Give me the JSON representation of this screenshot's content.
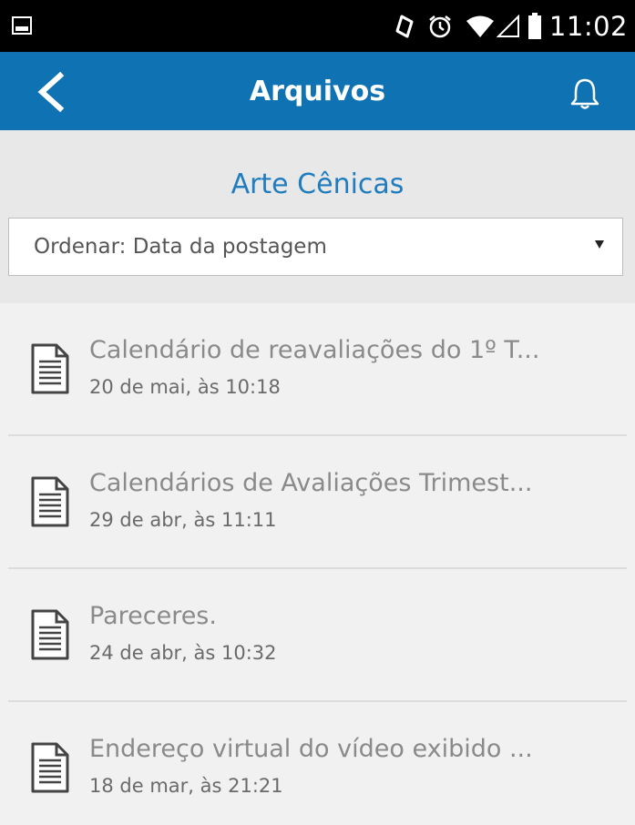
{
  "status_bar": {
    "time": "11:02",
    "icons": [
      "image-notification-icon",
      "rotate-icon",
      "alarm-icon",
      "wifi-icon",
      "signal-icon",
      "battery-icon"
    ]
  },
  "app_bar": {
    "title": "Arquivos",
    "background": "#0f72b3",
    "icons": [
      "back-arrow-icon",
      "bell-icon"
    ]
  },
  "section": {
    "title": "Arte Cênicas",
    "title_color": "#1f7dbf"
  },
  "sort": {
    "selected": "Ordenar: Data da postagem"
  },
  "files": [
    {
      "name": "Calendário de reavaliações do 1º T...",
      "date": "20 de mai, às 10:18",
      "icon": "document-icon"
    },
    {
      "name": "Calendários de Avaliações Trimest...",
      "date": "29 de abr, às 11:11",
      "icon": "document-icon"
    },
    {
      "name": "Pareceres.",
      "date": "24 de abr, às 10:32",
      "icon": "document-icon"
    },
    {
      "name": "Endereço virtual do vídeo exibido ...",
      "date": "18 de mar, às 21:21",
      "icon": "document-icon"
    }
  ]
}
